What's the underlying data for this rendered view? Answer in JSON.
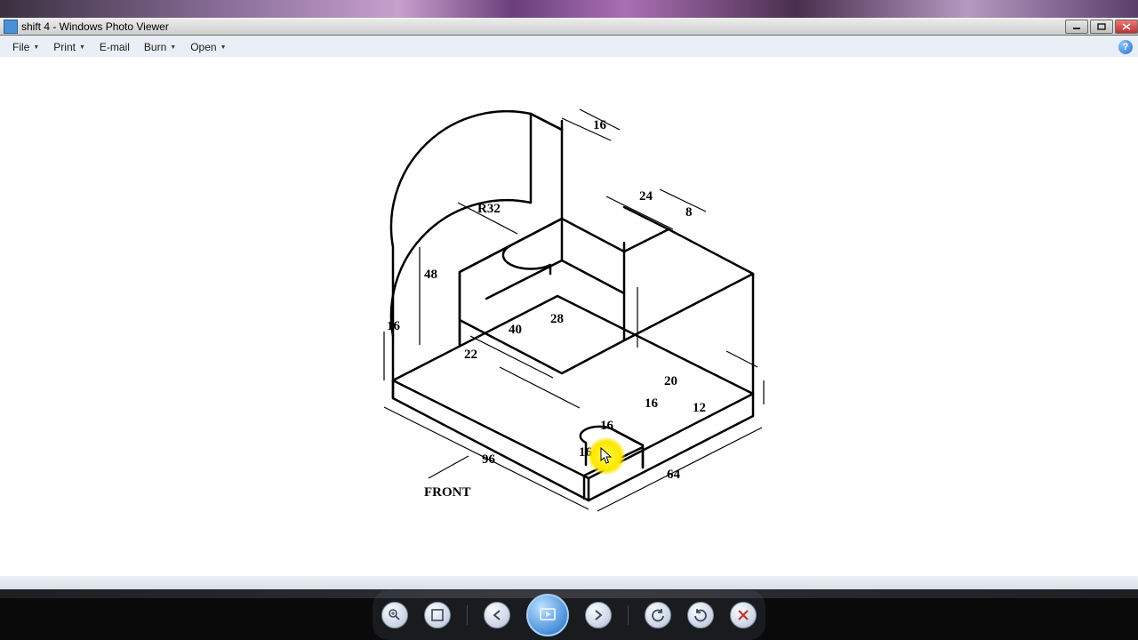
{
  "window": {
    "title": "shift 4 - Windows Photo Viewer"
  },
  "menu": {
    "file": "File",
    "print": "Print",
    "email": "E-mail",
    "burn": "Burn",
    "open": "Open"
  },
  "drawing": {
    "front_label": "FRONT",
    "dims": {
      "d16_top": "16",
      "r32": "R32",
      "d24": "24",
      "d8": "8",
      "d48": "48",
      "d16_left": "16",
      "d40": "40",
      "d28": "28",
      "d22": "22",
      "d20": "20",
      "d16_slot_r": "16",
      "d16_slot_l": "16",
      "d12": "12",
      "d16_height": "16",
      "d96": "96",
      "d64": "64"
    }
  },
  "toolbar_tips": {
    "zoom": "Zoom",
    "actual": "Actual size",
    "prev": "Previous",
    "play": "Play slide show",
    "next": "Next",
    "ccw": "Rotate counterclockwise",
    "cw": "Rotate clockwise",
    "del": "Delete"
  }
}
